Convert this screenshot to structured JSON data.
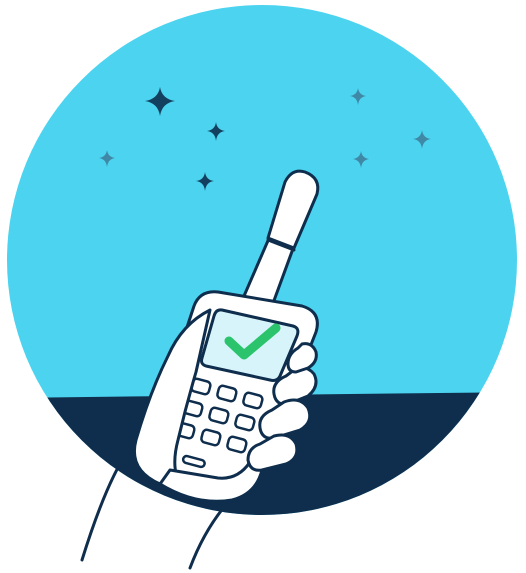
{
  "illustration": {
    "subject": "hand-holding-satellite-phone",
    "icons": [
      "star-icon",
      "checkmark-icon",
      "satellite-phone-icon",
      "hand-icon"
    ],
    "colors": {
      "sky": "#4cd3ef",
      "ground": "#0f2e4d",
      "outline": "#0f2e4d",
      "star_dark": "#13405f",
      "star_light": "#3f88a6",
      "screen": "#d8f4fb",
      "check": "#2bc46c",
      "phone_body": "#ffffff",
      "background": "#ffffff"
    }
  }
}
